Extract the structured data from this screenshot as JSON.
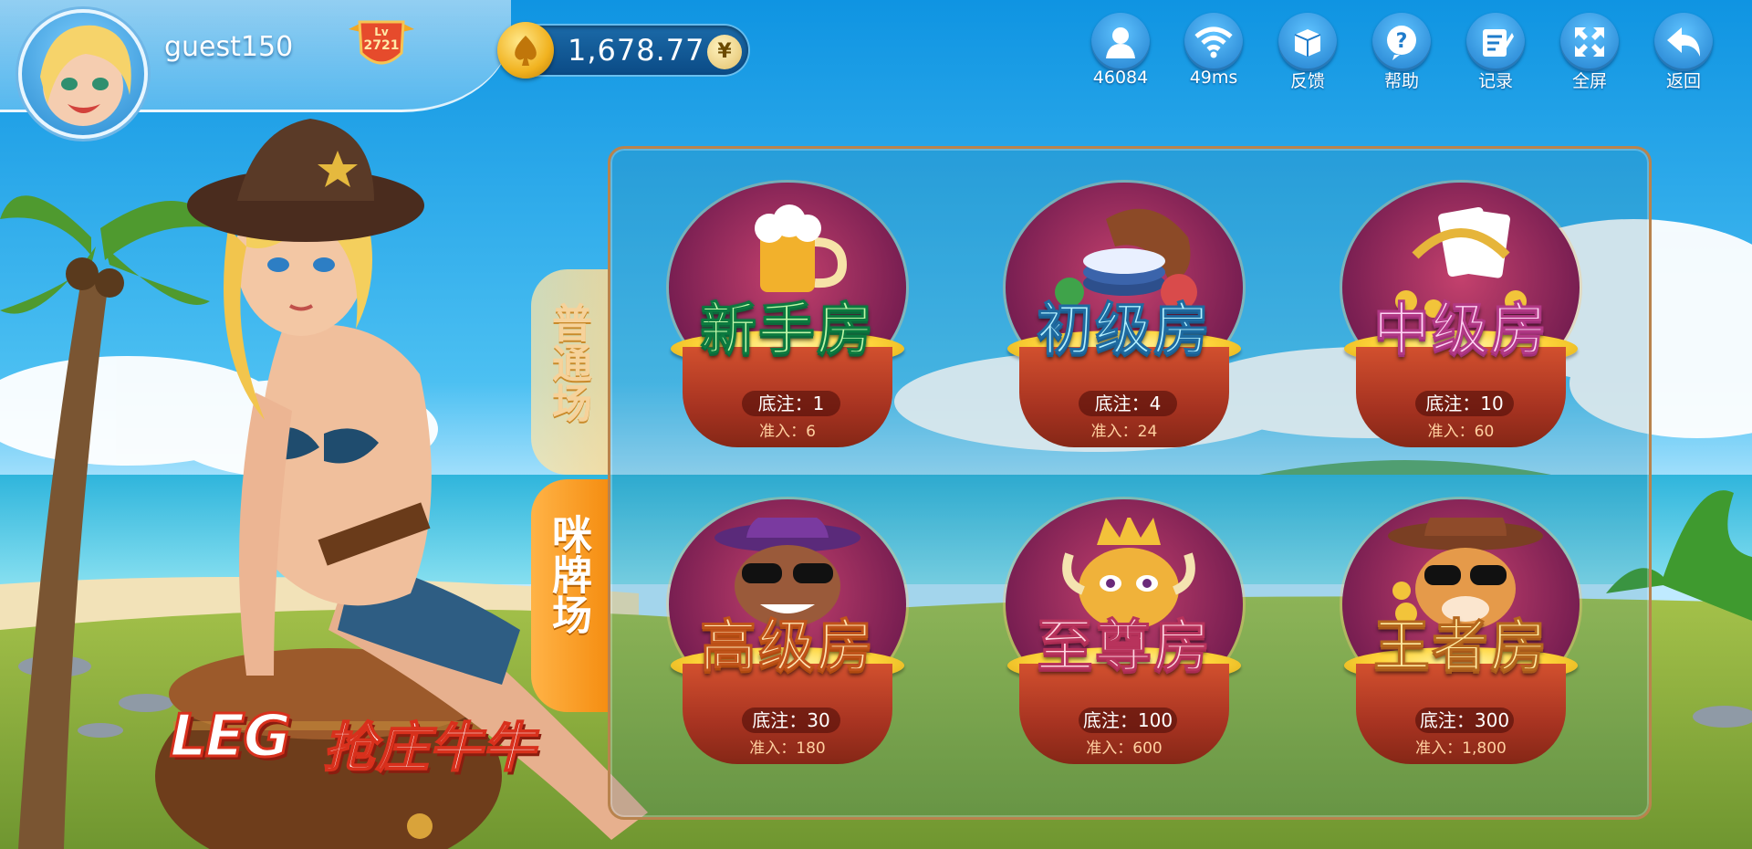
{
  "user": {
    "name": "guest150",
    "level_prefix": "Lv",
    "level": "2721"
  },
  "wallet": {
    "balance": "1,678.77",
    "currency_symbol": "¥"
  },
  "toolbar": [
    {
      "icon": "players-icon",
      "label": "46084"
    },
    {
      "icon": "wifi-icon",
      "label": "49ms"
    },
    {
      "icon": "feedback-icon",
      "label": "反馈"
    },
    {
      "icon": "help-icon",
      "label": "帮助"
    },
    {
      "icon": "record-icon",
      "label": "记录"
    },
    {
      "icon": "fullscreen-icon",
      "label": "全屏"
    },
    {
      "icon": "back-icon",
      "label": "返回"
    }
  ],
  "tabs": [
    {
      "label": "普通场",
      "active": false
    },
    {
      "label": "咪牌场",
      "active": true
    }
  ],
  "rooms": [
    {
      "name": "新手房",
      "bet": "底注：1",
      "entry": "准入：6"
    },
    {
      "name": "初级房",
      "bet": "底注：4",
      "entry": "准入：24"
    },
    {
      "name": "中级房",
      "bet": "底注：10",
      "entry": "准入：60"
    },
    {
      "name": "高级房",
      "bet": "底注：30",
      "entry": "准入：180"
    },
    {
      "name": "至尊房",
      "bet": "底注：100",
      "entry": "准入：600"
    },
    {
      "name": "王者房",
      "bet": "底注：300",
      "entry": "准入：1,800"
    }
  ],
  "logo": {
    "latin": "LEG",
    "chinese": "抢庄牛牛"
  },
  "colors": {
    "sky_top": "#1aa3ea",
    "sea": "#3fc1d9",
    "grass": "#8fb13a",
    "panel_border": "#b9834d",
    "tab_active": "#f58d10",
    "coin_gold": "#f1b21f"
  }
}
